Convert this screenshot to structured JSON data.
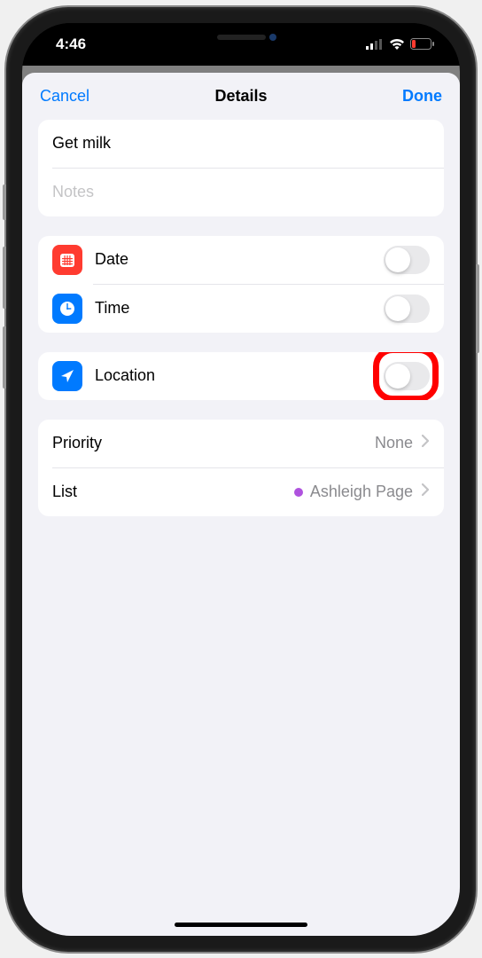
{
  "status": {
    "time": "4:46"
  },
  "sheet": {
    "cancel": "Cancel",
    "title": "Details",
    "done": "Done"
  },
  "reminder": {
    "title": "Get milk",
    "notes_placeholder": "Notes"
  },
  "rows": {
    "date": "Date",
    "time": "Time",
    "location": "Location"
  },
  "priority": {
    "label": "Priority",
    "value": "None"
  },
  "list": {
    "label": "List",
    "value": "Ashleigh Page"
  }
}
